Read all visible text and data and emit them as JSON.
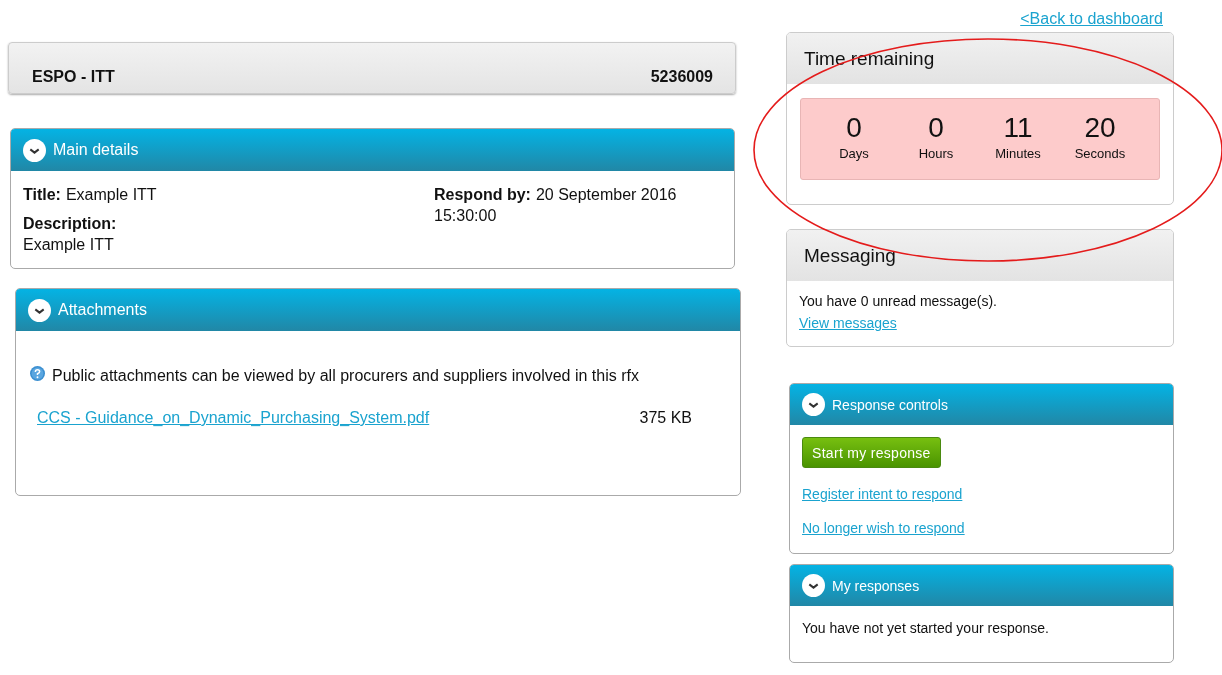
{
  "back_link": "<Back to dashboard",
  "header": {
    "title": "ESPO - ITT",
    "number": "5236009"
  },
  "main_details": {
    "heading": "Main details",
    "left": [
      {
        "kind": "inline",
        "label": "Title:",
        "value": "Example ITT"
      },
      {
        "kind": "stacked",
        "label": "Description:",
        "value": "Example ITT"
      }
    ],
    "right": [
      {
        "kind": "inline",
        "label": "Respond by:",
        "value": "20 September 2016 15:30:00"
      }
    ]
  },
  "attachments": {
    "heading": "Attachments",
    "note": "Public attachments can be viewed by all procurers and suppliers involved in this rfx",
    "files": [
      {
        "name": "CCS - Guidance_on_Dynamic_Purchasing_System.pdf",
        "size": "375 KB"
      }
    ]
  },
  "time_remaining": {
    "heading": "Time remaining",
    "units": [
      {
        "value": "0",
        "label": "Days"
      },
      {
        "value": "0",
        "label": "Hours"
      },
      {
        "value": "11",
        "label": "Minutes"
      },
      {
        "value": "20",
        "label": "Seconds"
      }
    ]
  },
  "messaging": {
    "heading": "Messaging",
    "text": "You have 0 unread message(s).",
    "link": "View messages"
  },
  "response_controls": {
    "heading": "Response controls",
    "button": "Start my response",
    "links": [
      "Register intent to respond",
      "No longer wish to respond"
    ]
  },
  "my_responses": {
    "heading": "My responses",
    "text": "You have not yet started your response."
  }
}
